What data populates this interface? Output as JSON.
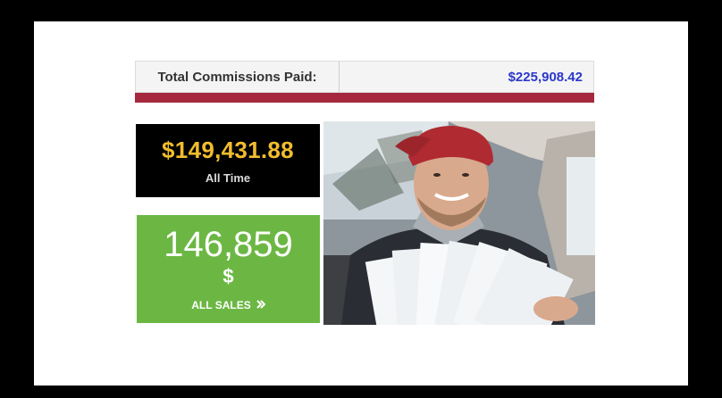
{
  "commissions": {
    "label": "Total Commissions Paid:",
    "value": "$225,908.42"
  },
  "all_time": {
    "amount": "$149,431.88",
    "label": "All Time"
  },
  "all_sales": {
    "count": "146,859",
    "currency": "$",
    "label": "ALL SALES"
  },
  "icons": {
    "sales_link": "chevron-right-double-icon"
  },
  "colors": {
    "commission_value": "#2b38c9",
    "underline": "#a5283e",
    "all_time_amount": "#f1bd2e",
    "all_sales_bg": "#6cb744"
  }
}
